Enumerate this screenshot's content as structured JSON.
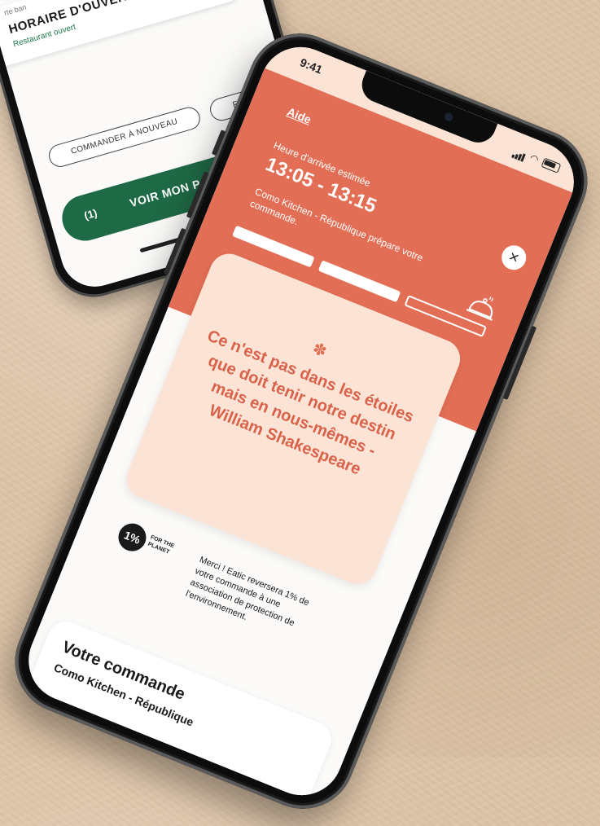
{
  "back_screen": {
    "card_subtext": "rte ban",
    "hours_title": "HORAIRE D'OUVERTURE",
    "restaurant_status": "Restaurant ouvert",
    "chips": [
      "COMMANDER À NOUVEAU",
      "FARMER VEGAN"
    ],
    "cart_count": "(1)",
    "cart_label": "VOIR MON PANIER"
  },
  "front_screen": {
    "status_time": "9:41",
    "help_label": "Aide",
    "eta_label": "Heure d'arrivée estimée",
    "eta_time": "13:05 - 13:15",
    "prep_text": "Como Kitchen - République prépare votre commande.",
    "close_glyph": "×",
    "progress_steps_completed": 2,
    "progress_steps_total": 3,
    "quote_icon": "✽",
    "quote": "Ce n'est pas dans les étoiles que doit tenir notre destin mais en nous-mêmes - William Shakespeare",
    "planet_logo_mark": "1%",
    "planet_logo_text": "FOR THE PLANET",
    "planet_message": "Merci ! Eatic reversera 1% de votre commande à une association de protection de l'environnement.",
    "order_title": "Votre commande",
    "order_restaurant": "Como Kitchen - République"
  },
  "colors": {
    "accent_orange": "#e26e55",
    "card_peach": "#fbe3d5",
    "primary_green": "#1f6a46",
    "background": "#dcc3a6"
  },
  "icons": [
    "signal-icon",
    "wifi-icon",
    "battery-icon",
    "close-icon",
    "cloche-icon",
    "flower-icon",
    "planet-logo"
  ]
}
